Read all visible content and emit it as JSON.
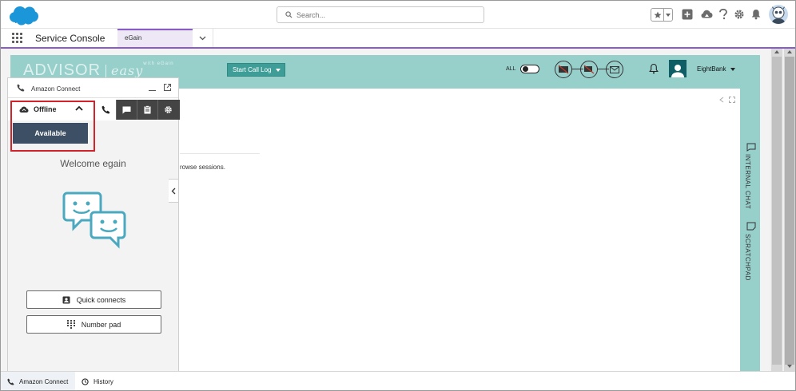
{
  "header": {
    "search_placeholder": "Search...",
    "icons": [
      "favorites-star-icon",
      "chevron-down-icon",
      "add-icon",
      "trailhead-icon",
      "help-icon",
      "gear-icon",
      "bell-icon",
      "user-avatar"
    ]
  },
  "nav": {
    "app_name": "Service Console",
    "tab_label": "eGain",
    "accent_color": "#8a5cc7"
  },
  "advisor": {
    "logo_main": "ADVISOR",
    "logo_easy": "easy",
    "logo_with": "with eGain",
    "call_log_label": "Start Call Log",
    "all_label": "ALL",
    "bank_label": "EightBank",
    "browse_text": "rowse sessions.",
    "rail_internal_chat": "INTERNAL CHAT",
    "rail_scratchpad": "SCRATCHPAD",
    "teal_color": "#97cfcb"
  },
  "amazon_connect": {
    "title": "Amazon Connect",
    "status": "Offline",
    "dropdown_option": "Available",
    "welcome": "Welcome egain",
    "quick_connects": "Quick connects",
    "number_pad": "Number pad"
  },
  "utility_bar": {
    "amazon_connect": "Amazon Connect",
    "history": "History"
  }
}
